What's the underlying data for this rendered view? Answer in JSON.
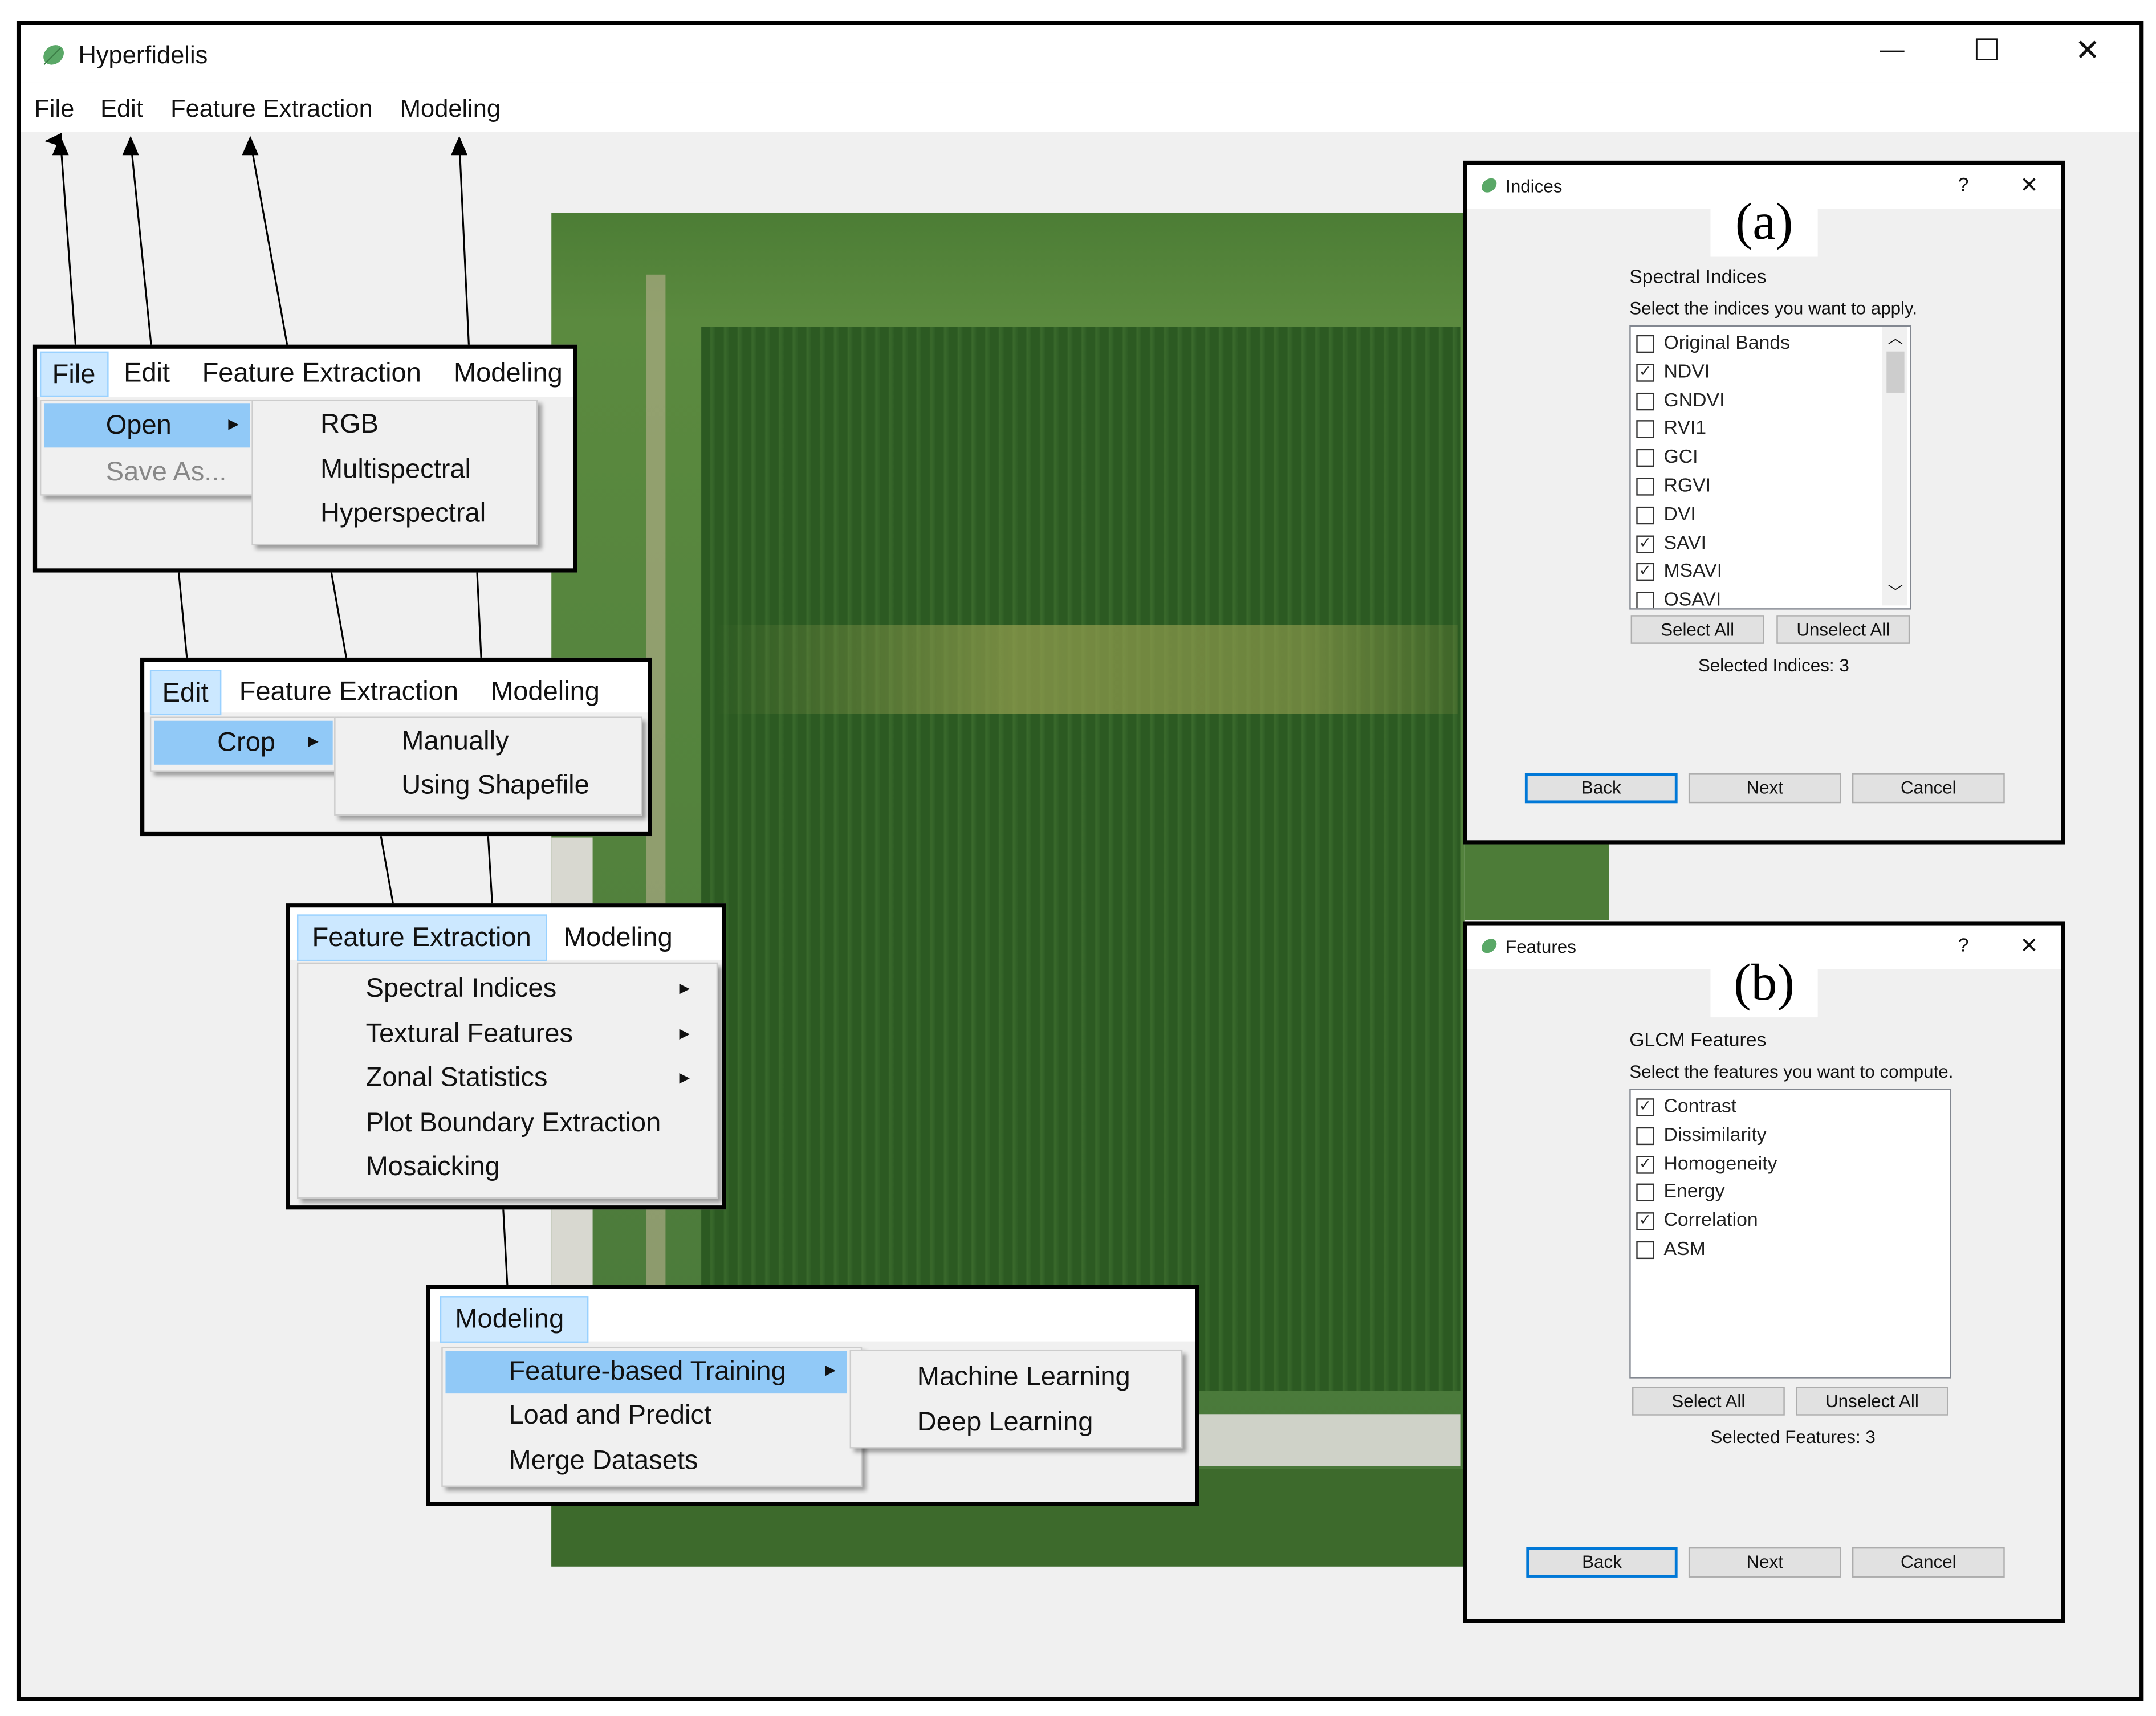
{
  "window": {
    "title": "Hyperfidelis",
    "minimize_label": "—",
    "maximize_label": "☐",
    "close_label": "✕",
    "accent": "#91c9f7"
  },
  "menu": {
    "file": "File",
    "edit": "Edit",
    "feature_extraction": "Feature Extraction",
    "modeling": "Modeling"
  },
  "file_menu": {
    "items": [
      "Open",
      "Save As..."
    ],
    "open_submenu": [
      "RGB",
      "Multispectral",
      "Hyperspectral"
    ]
  },
  "edit_menu": {
    "items": [
      "Crop"
    ],
    "crop_submenu": [
      "Manually",
      "Using Shapefile"
    ]
  },
  "feature_menu": {
    "items": [
      "Spectral Indices",
      "Textural Features",
      "Zonal Statistics",
      "Plot Boundary Extraction",
      "Mosaicking"
    ]
  },
  "modeling_menu": {
    "items": [
      "Feature-based Training",
      "Load and Predict",
      "Merge Datasets"
    ],
    "training_submenu": [
      "Machine Learning",
      "Deep Learning"
    ]
  },
  "dialog_a": {
    "title": "Indices",
    "help": "?",
    "close": "✕",
    "panel_label": "(a)",
    "heading": "Spectral Indices",
    "subtitle": "Select the indices you want to apply.",
    "items": [
      {
        "label": "Original Bands",
        "checked": false
      },
      {
        "label": "NDVI",
        "checked": true
      },
      {
        "label": "GNDVI",
        "checked": false
      },
      {
        "label": "RVI1",
        "checked": false
      },
      {
        "label": "GCI",
        "checked": false
      },
      {
        "label": "RGVI",
        "checked": false
      },
      {
        "label": "DVI",
        "checked": false
      },
      {
        "label": "SAVI",
        "checked": true
      },
      {
        "label": "MSAVI",
        "checked": true
      },
      {
        "label": "OSAVI",
        "checked": false
      }
    ],
    "select_all": "Select All",
    "unselect_all": "Unselect All",
    "status": "Selected Indices: 3",
    "back": "Back",
    "next": "Next",
    "cancel": "Cancel"
  },
  "dialog_b": {
    "title": "Features",
    "help": "?",
    "close": "✕",
    "panel_label": "(b)",
    "heading": "GLCM Features",
    "subtitle": "Select the features you want to compute.",
    "items": [
      {
        "label": "Contrast",
        "checked": true
      },
      {
        "label": "Dissimilarity",
        "checked": false
      },
      {
        "label": "Homogeneity",
        "checked": true
      },
      {
        "label": "Energy",
        "checked": false
      },
      {
        "label": "Correlation",
        "checked": true
      },
      {
        "label": "ASM",
        "checked": false
      }
    ],
    "select_all": "Select All",
    "unselect_all": "Unselect All",
    "status": "Selected Features: 3",
    "back": "Back",
    "next": "Next",
    "cancel": "Cancel"
  }
}
